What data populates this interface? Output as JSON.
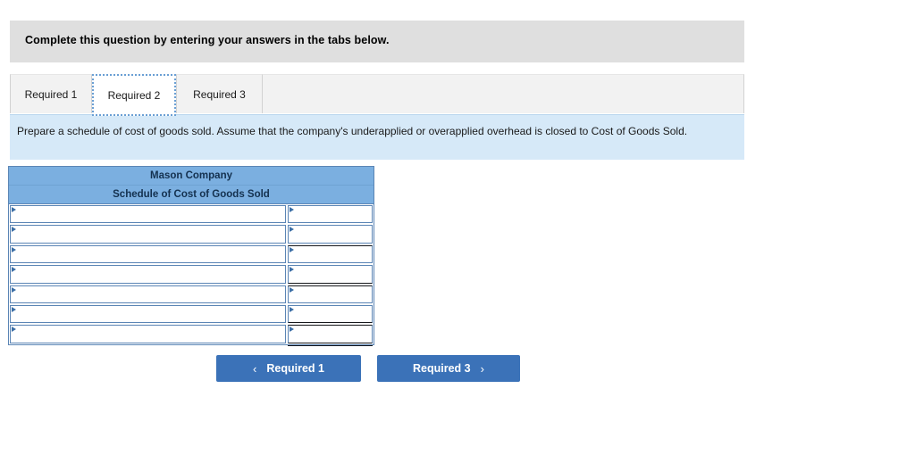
{
  "banner": {
    "message": "Complete this question by entering your answers in the tabs below."
  },
  "tabs": {
    "items": [
      {
        "label": "Required 1",
        "active": false
      },
      {
        "label": "Required 2",
        "active": true
      },
      {
        "label": "Required 3",
        "active": false
      }
    ]
  },
  "instruction": {
    "text": "Prepare a schedule of cost of goods sold. Assume that the company's underapplied or overapplied overhead is closed to Cost of Goods Sold."
  },
  "schedule": {
    "company_name": "Mason Company",
    "title": "Schedule of Cost of Goods Sold",
    "rows": [
      {
        "label": "",
        "value": "",
        "label_placeholder": "",
        "value_placeholder": "",
        "value_top_rule": false,
        "value_bottom_rule": false
      },
      {
        "label": "",
        "value": "",
        "label_placeholder": "",
        "value_placeholder": "",
        "value_top_rule": false,
        "value_bottom_rule": false
      },
      {
        "label": "",
        "value": "",
        "label_placeholder": "",
        "value_placeholder": "",
        "value_top_rule": true,
        "value_bottom_rule": false
      },
      {
        "label": "",
        "value": "",
        "label_placeholder": "",
        "value_placeholder": "",
        "value_top_rule": false,
        "value_bottom_rule": true
      },
      {
        "label": "",
        "value": "",
        "label_placeholder": "",
        "value_placeholder": "",
        "value_top_rule": true,
        "value_bottom_rule": false
      },
      {
        "label": "",
        "value": "",
        "label_placeholder": "",
        "value_placeholder": "",
        "value_top_rule": false,
        "value_bottom_rule": true
      },
      {
        "label": "",
        "value": "",
        "label_placeholder": "",
        "value_placeholder": "",
        "value_top_rule": true,
        "value_bottom_rule": true
      }
    ]
  },
  "footer": {
    "prev_label": "Required 1",
    "prev_icon": "chevron-left-icon",
    "prev_chevron": "‹",
    "next_label": "Required 3",
    "next_icon": "chevron-right-icon",
    "next_chevron": "›"
  },
  "colors": {
    "banner_bg": "#dfdfdf",
    "instruction_bg": "#d6e9f8",
    "table_header_bg": "#7bafe0",
    "table_border": "#5b85b5",
    "button_bg": "#3b72b8",
    "tab_inactive_bg": "#f2f2f2",
    "tab_active_bg": "#ffffff",
    "focus_outline": "#6a9fd4"
  }
}
